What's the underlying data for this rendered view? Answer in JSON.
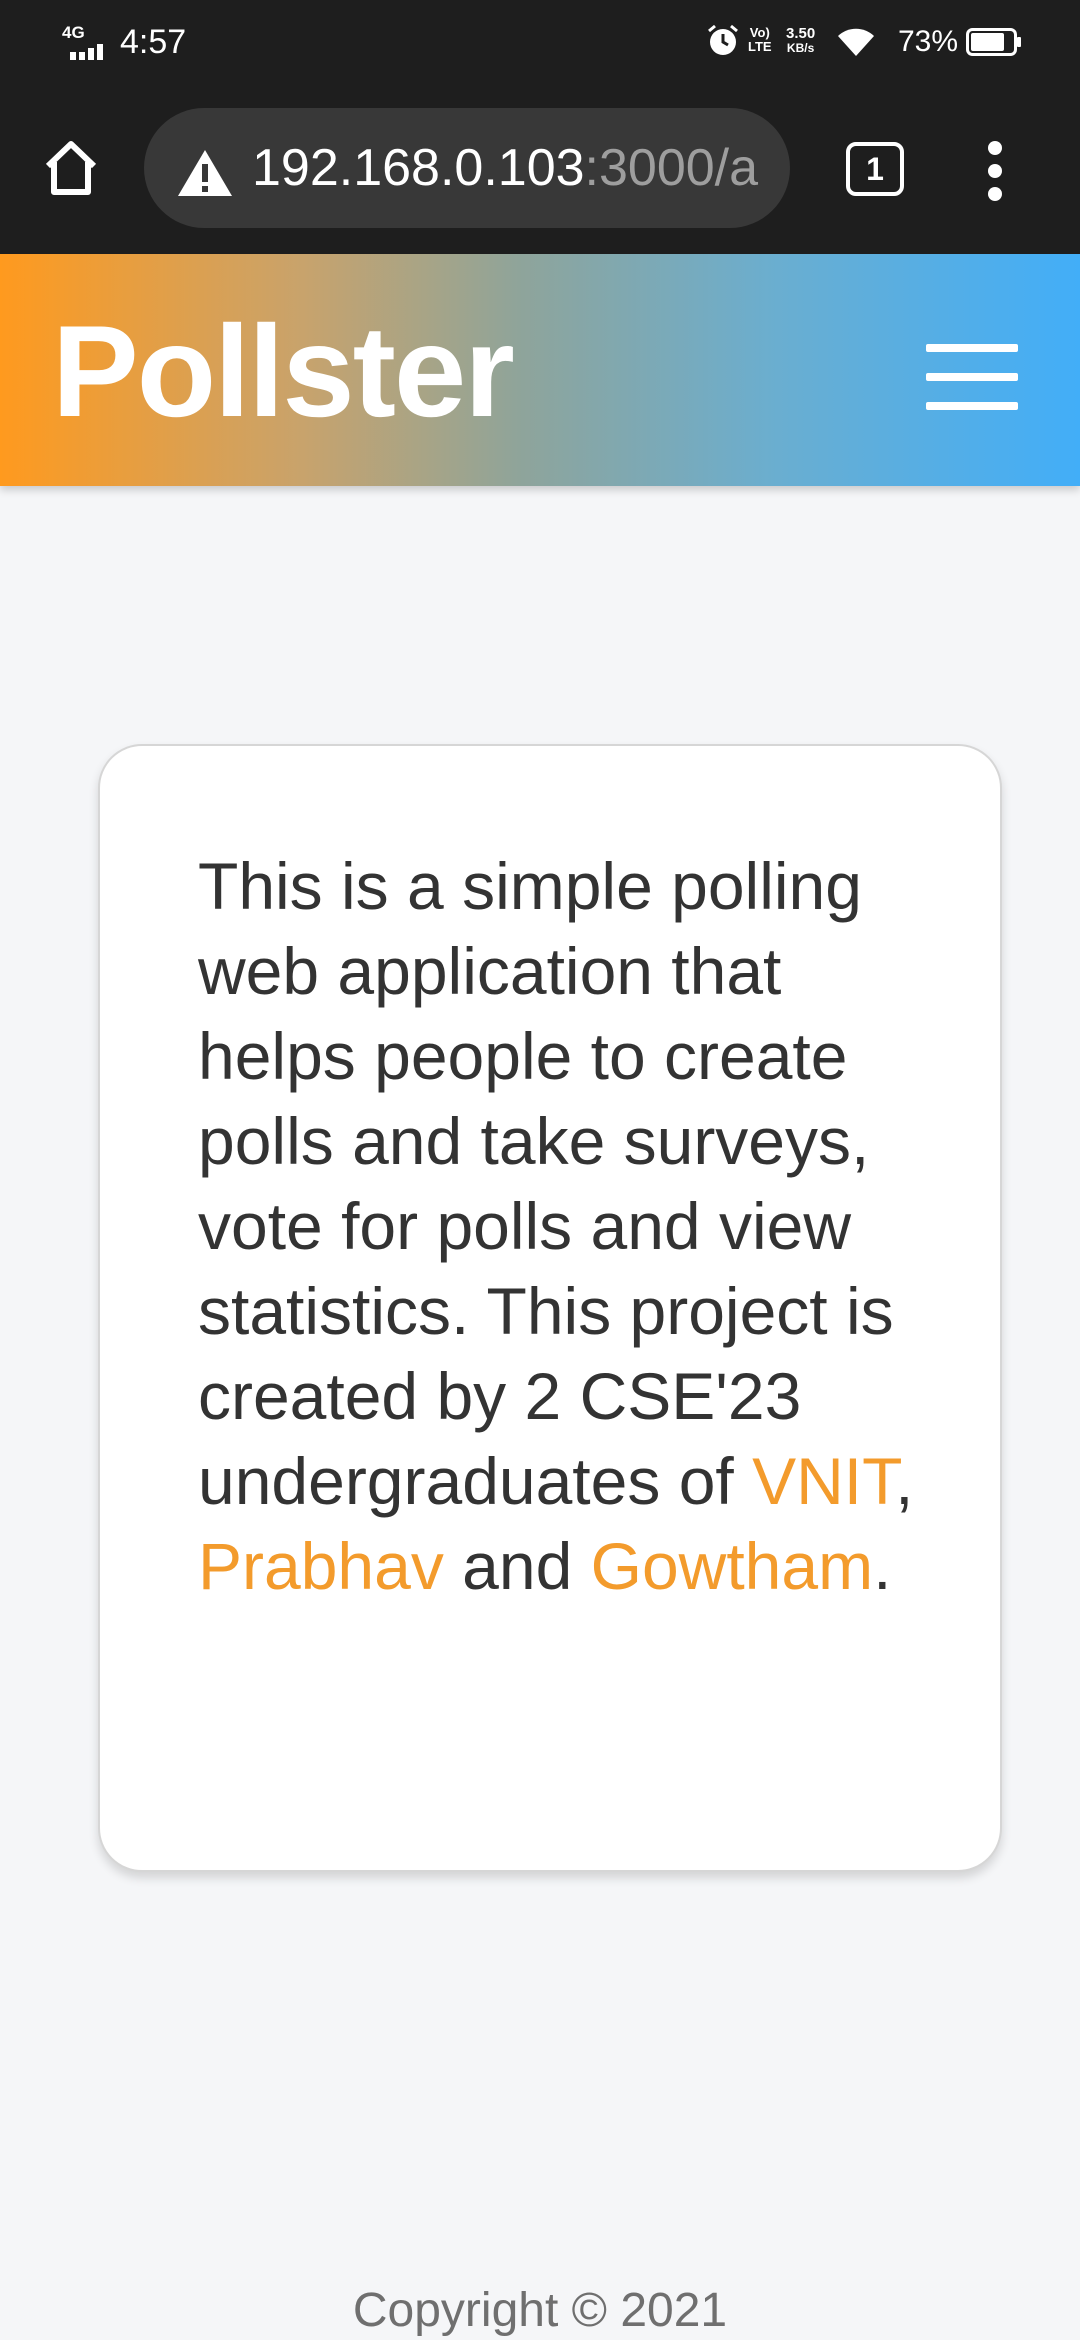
{
  "status_bar": {
    "network": "4G",
    "time": "4:57",
    "volte_top": "Vo)",
    "volte_bottom": "LTE",
    "speed_value": "3.50",
    "speed_unit": "KB/s",
    "battery": "73%",
    "icons": [
      "signal-icon",
      "alarm-icon",
      "wifi-icon",
      "battery-icon"
    ]
  },
  "browser": {
    "url_host": "192.168.0.103",
    "url_rest": ":3000/a",
    "tab_count": "1",
    "icons": [
      "home-icon",
      "warning-icon",
      "tabs-icon",
      "more-vert-icon"
    ]
  },
  "header": {
    "brand": "Pollster",
    "gradient_start": "#ff9a1e",
    "gradient_end": "#42aef8",
    "menu_icon": "hamburger-icon"
  },
  "about": {
    "text_before": "This is a simple polling web application that helps people to create polls and take surveys, vote for polls and view statistics. This project is created by 2 CSE'23 undergraduates of ",
    "link_vnit": "VNIT",
    "sep1": ", ",
    "link_prabhav": "Prabhav",
    "sep2": " and ",
    "link_gowtham": "Gowtham",
    "end": ".",
    "link_color": "#f39b2c"
  },
  "footer": {
    "copyright": "Copyright © 2021"
  }
}
